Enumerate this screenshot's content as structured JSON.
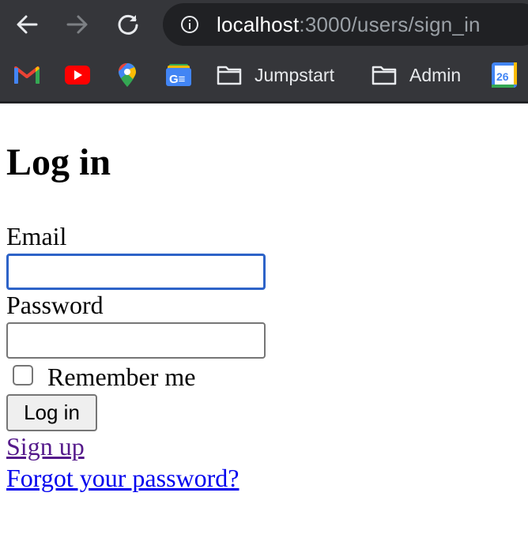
{
  "browser": {
    "url_host": "localhost",
    "url_path": ":3000/users/sign_in",
    "bookmarks": [
      {
        "icon": "gmail-icon",
        "label": ""
      },
      {
        "icon": "youtube-icon",
        "label": ""
      },
      {
        "icon": "google-maps-icon",
        "label": ""
      },
      {
        "icon": "google-news-icon",
        "label": ""
      },
      {
        "icon": "folder-icon",
        "label": "Jumpstart"
      },
      {
        "icon": "folder-icon",
        "label": "Admin"
      },
      {
        "icon": "google-calendar-icon",
        "label": "26"
      }
    ]
  },
  "page": {
    "title": "Log in",
    "email_label": "Email",
    "email_value": "",
    "password_label": "Password",
    "password_value": "",
    "remember_label": "Remember me",
    "remember_checked": false,
    "submit_label": "Log in",
    "signup_link": "Sign up",
    "forgot_link": "Forgot your password?"
  },
  "colors": {
    "chrome_bg": "#35363a",
    "omnibox_bg": "#202124",
    "focus_ring": "#2d63c8",
    "visited_link": "#551a8b",
    "link": "#0000ee"
  }
}
